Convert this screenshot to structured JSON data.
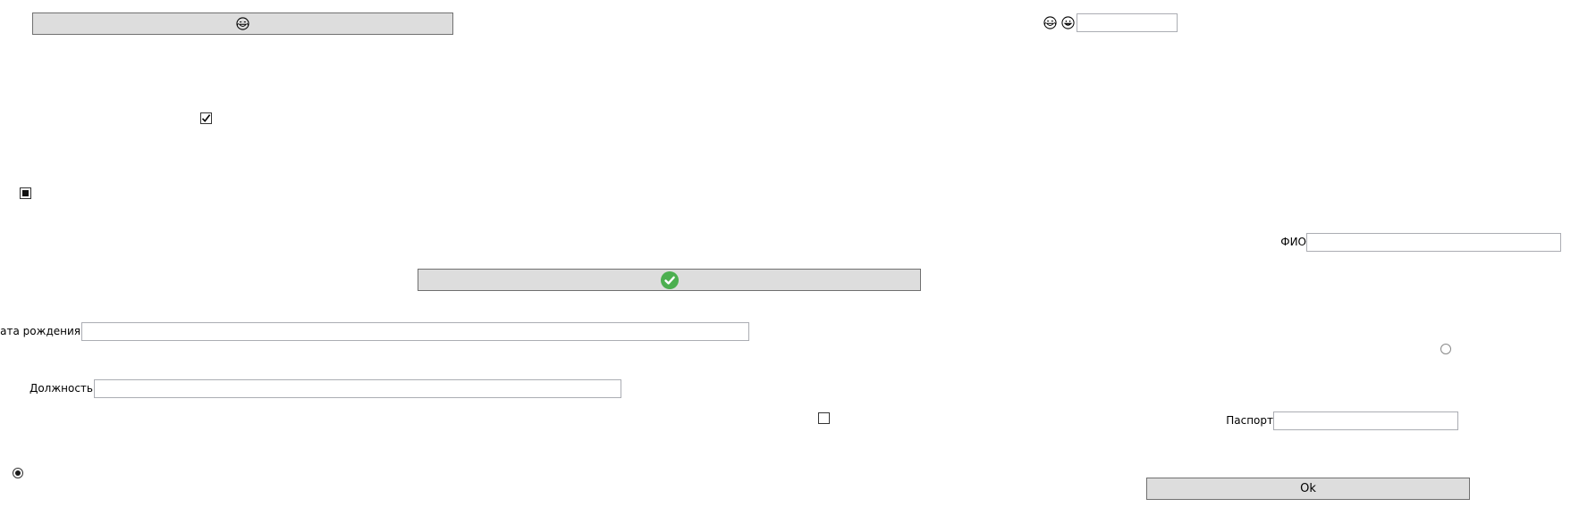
{
  "top_button": {
    "icon": "grinning-face-with-tears-icon"
  },
  "emoji_pair": {
    "icons": [
      "grinning-face-with-tears-icon",
      "grinning-face-icon"
    ]
  },
  "emoji_field": {
    "value": ""
  },
  "checkboxes": {
    "checked": {
      "state": "checked"
    },
    "indeterminate": {
      "state": "indeterminate"
    },
    "unchecked": {
      "state": "unchecked"
    }
  },
  "confirm_button": {
    "icon": "green-check-circle-icon",
    "icon_color": "#4caf50"
  },
  "form": {
    "fio_label": "ФИО",
    "fio_value": "",
    "birth_date_label": "Дата рождения",
    "birth_date_value": "",
    "position_label": "Должность",
    "position_value": "",
    "passport_label": "Паспорт",
    "passport_value": ""
  },
  "radios": {
    "selected": {
      "state": "selected"
    },
    "unselected": {
      "state": "unselected"
    }
  },
  "ok_button": {
    "label": "Ok"
  },
  "colors": {
    "button_bg": "#dddddd",
    "button_border": "#707070",
    "input_border": "#abadb3",
    "check_green": "#4caf50"
  }
}
